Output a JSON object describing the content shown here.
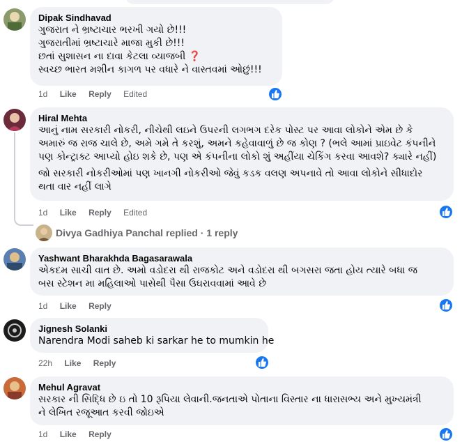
{
  "comments": [
    {
      "author": "Dipak Sindhavad",
      "lines": [
        "ગુજરાત ને ભ્રષ્ટાચાર ભરખી ગયો છે!!!",
        "ગુજરાતીમાં ભ્રષ્ટાચારે માજા મુકી છે!!!",
        "છતાં સુશાસન ના દાવા કેટલા વ્યાજબી",
        "સ્વચ્છ ભારત મશીન કાગળ પર વધારે ને વાસ્તવમાં ઓછું!!!"
      ],
      "question_mark": "❓",
      "time": "1d",
      "like": "Like",
      "reply": "Reply",
      "edited": "Edited"
    },
    {
      "author": "Hiral Mehta",
      "lines": [
        "આનું નામ સરકારી નોકરી, નીચેથી લઇને ઉપરની લગભગ દરેક પોસ્ટ પર આવા લોકોને એમ છે કે",
        "અમારું જ રાજ ચાલે છે, અમે ગમે તે કરશું, અમને કહેવાવાળું છે જ કોણ ? (ભલે આમાં પ્રાઇવેટ કંપનીને",
        "પણ કોન્ટ્રાક્ટ આપ્યો હોઇ શકે છે, પણ એ કંપનીના લોકો શું અહીંયા ચેકિંગ કરવા આવશે? ક્યારે નહીં)"
      ],
      "lines2": [
        "જો સરકારી નોકરીઓમાં પણ ખાનગી નોકરીઓ જેવું કડક વલણ અપનાવે તો આવા લોકોને સીધાદોર",
        "થતા વાર નહીં લાગે"
      ],
      "time": "1d",
      "like": "Like",
      "reply": "Reply",
      "edited": "Edited",
      "replies_text": "Divya Gadhiya Panchal replied · 1 reply"
    },
    {
      "author": "Yashwant Bharakhda Bagasarawala",
      "lines": [
        "એકદમ સાચી વાત છે. અમો વડોદરા થી રાજકોટ અને વડોદરા થી બગસરા જતા હોય ત્યારે બધા જ",
        "બસ સ્ટેશન મા મહિલાઓ પાસેથી પૈસા ઉઘરાવવામાં આવે છે"
      ],
      "time": "1d",
      "like": "Like",
      "reply": "Reply"
    },
    {
      "author": "Jignesh Solanki",
      "lines": [
        "Narendra Modi saheb ki sarkar he to mumkin he"
      ],
      "time": "22h",
      "like": "Like",
      "reply": "Reply"
    },
    {
      "author": "Mehul Agravat",
      "lines": [
        "સરકાર ની સિદ્ધિ છે ઇ તો 10 રૂપિયા લેવાની.જનતાએ પોતાના વિસ્તાર ના ધારાસભ્ય અને મુખ્યમંત્રી",
        "ને લેખિત રજૂઆત કરવી જોઇએ"
      ],
      "time": "1d",
      "like": "Like",
      "reply": "Reply"
    }
  ],
  "icons": {
    "reaction": "thumbs-up-icon",
    "color": "#1877f2"
  }
}
